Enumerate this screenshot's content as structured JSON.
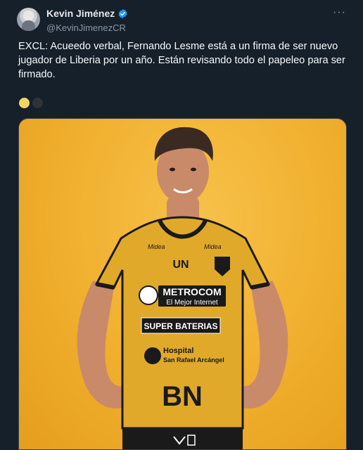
{
  "author": {
    "display_name": "Kevin Jiménez",
    "handle": "@KevinJimenezCR",
    "verified": true,
    "avatar_icon": "avatar"
  },
  "menu": {
    "icon": "more-icon",
    "glyph": "···"
  },
  "tweet": {
    "text": "EXCL: Acueedo verbal, Fernando Lesme está a un firma de ser nuevo jugador de Liberia por un año. Están revisando todo el papeleo para ser firmado."
  },
  "carousel": {
    "count": 2,
    "active_index": 0
  },
  "media": {
    "alt": "player photo",
    "jersey": {
      "sponsor_main": "METROCOM",
      "sponsor_tagline": "El Mejor Internet",
      "sponsor_2": "SUPER BATERIAS",
      "sponsor_3_line1": "Hospital",
      "sponsor_3_line2": "San Rafael Arcángel",
      "sponsor_4": "BN",
      "crest": "UN",
      "brand_left": "Midea",
      "brand_right": "Midea"
    }
  },
  "colors": {
    "background": "#15202b",
    "accent": "#1d9bf0",
    "dot_active": "#f6d365",
    "photo_bg": "#f2b232"
  }
}
